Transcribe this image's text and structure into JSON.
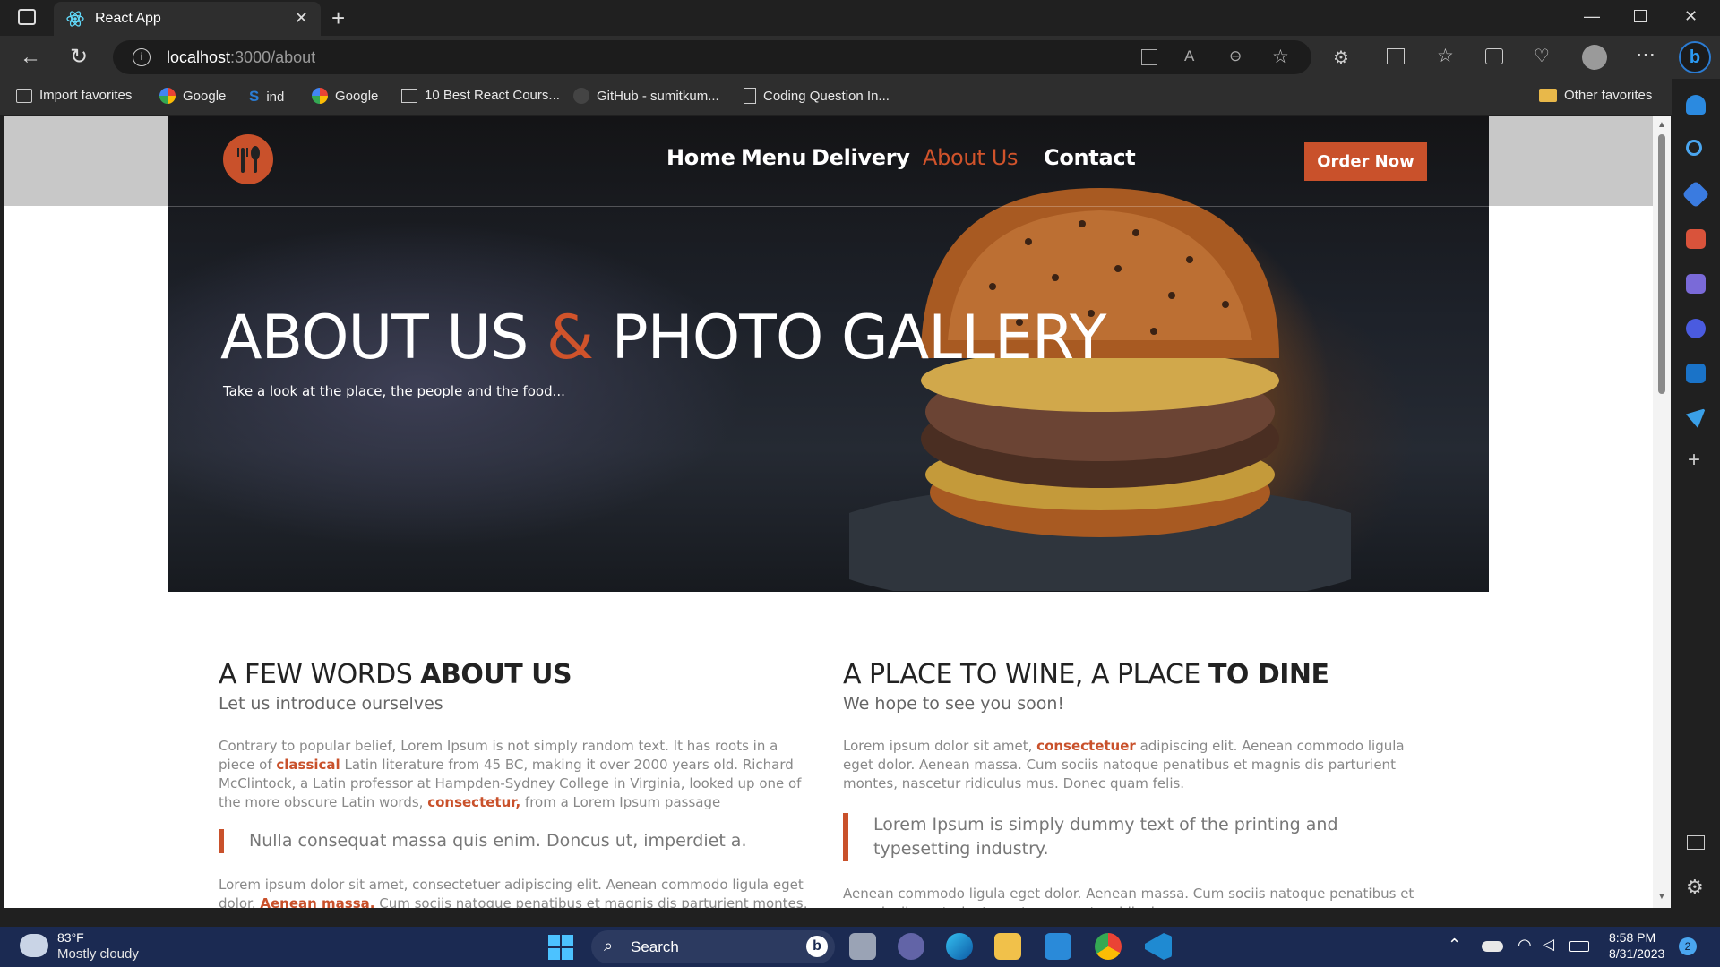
{
  "browser": {
    "tab_title": "React App",
    "url_host": "localhost",
    "url_rest": ":3000/about",
    "favorites": [
      {
        "label": "Import favorites",
        "icon": "import-icon"
      },
      {
        "label": "Google",
        "icon": "google-icon"
      },
      {
        "label": "ind",
        "icon": "s-icon"
      },
      {
        "label": "Google",
        "icon": "google-icon"
      },
      {
        "label": "10 Best React Cours...",
        "icon": "course-icon"
      },
      {
        "label": "GitHub - sumitkum...",
        "icon": "github-icon"
      },
      {
        "label": "Coding Question In...",
        "icon": "page-icon"
      }
    ],
    "other_favorites": "Other favorites"
  },
  "site": {
    "nav": [
      "Home",
      "Menu",
      "Delivery",
      "About Us",
      "Contact"
    ],
    "active_nav": "About Us",
    "order_button": "Order Now",
    "accent_color": "#c9512b",
    "hero": {
      "title_part1": "ABOUT US ",
      "amp": "&",
      "title_part2": " PHOTO GALLERY",
      "subtitle": "Take a look at the place, the people and the food..."
    },
    "left": {
      "title_light": "A FEW WORDS ",
      "title_bold": "ABOUT US",
      "subtitle": "Let us introduce ourselves",
      "p1_a": "Contrary to popular belief, Lorem Ipsum is not simply random text. It has roots in a piece of ",
      "p1_hl1": "classical",
      "p1_b": " Latin literature from 45 BC, making it over 2000 years old. Richard McClintock, a Latin professor at Hampden-Sydney College in Virginia, looked up one of the more obscure Latin words, ",
      "p1_hl2": "consectetur,",
      "p1_c": " from a Lorem Ipsum passage",
      "quote": "Nulla consequat massa quis enim. Doncus ut, imperdiet a.",
      "p2_a": "Lorem ipsum dolor sit amet, consectetuer adipiscing elit. Aenean commodo ligula eget dolor. ",
      "p2_hl": "Aenean massa.",
      "p2_b": " Cum sociis natoque penatibus et magnis dis parturient montes,"
    },
    "right": {
      "title_light": "A PLACE TO WINE, A PLACE ",
      "title_bold": "TO DINE",
      "subtitle": "We hope to see you soon!",
      "p1_a": "Lorem ipsum dolor sit amet, ",
      "p1_hl": "consectetuer",
      "p1_b": " adipiscing elit. Aenean commodo ligula eget dolor. Aenean massa. Cum sociis natoque penatibus et magnis dis parturient montes, nascetur ridiculus mus. Donec quam felis.",
      "quote": "Lorem Ipsum is simply dummy text of the printing and typesetting industry.",
      "p2": "Aenean commodo ligula eget dolor. Aenean massa. Cum sociis natoque penatibus et magnis dis parturient montes, nascetur ridiculus mus."
    }
  },
  "taskbar": {
    "temperature": "83°F",
    "weather": "Mostly cloudy",
    "search_label": "Search",
    "time": "8:58 PM",
    "date": "8/31/2023",
    "notification_count": "2"
  }
}
